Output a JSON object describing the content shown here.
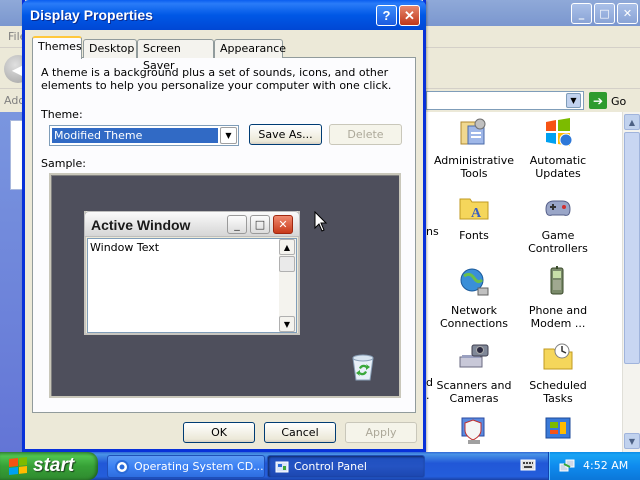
{
  "background_window": {
    "menu_file": "File",
    "address_label": "Address",
    "go_label": "Go",
    "items": [
      {
        "label_line1": "Administrative",
        "label_line2": "Tools",
        "icon": "administrative-tools-icon"
      },
      {
        "label_line1": "Automatic",
        "label_line2": "Updates",
        "icon": "automatic-updates-icon"
      },
      {
        "label_line1": "Fonts",
        "label_line2": "",
        "icon": "fonts-folder-icon"
      },
      {
        "label_line1": "Game",
        "label_line2": "Controllers",
        "icon": "game-controllers-icon"
      },
      {
        "label_line1": "Network",
        "label_line2": "Connections",
        "icon": "network-connections-icon"
      },
      {
        "label_line1": "Phone and",
        "label_line2": "Modem ...",
        "icon": "phone-and-modem-icon"
      },
      {
        "label_line1": "Scanners and",
        "label_line2": "Cameras",
        "icon": "scanners-cameras-icon"
      },
      {
        "label_line1": "Scheduled",
        "label_line2": "Tasks",
        "icon": "scheduled-tasks-icon"
      },
      {
        "label_line1": "",
        "label_line2": "",
        "icon": "security-center-icon"
      },
      {
        "label_line1": "",
        "label_line2": "",
        "icon": "system-icon"
      }
    ],
    "partial_labels": [
      "ns",
      "d",
      "."
    ]
  },
  "dialog": {
    "title": "Display Properties",
    "help_symbol": "?",
    "close_symbol": "✕",
    "tabs": [
      {
        "label": "Themes",
        "active": true
      },
      {
        "label": "Desktop",
        "active": false
      },
      {
        "label": "Screen Saver",
        "active": false
      },
      {
        "label": "Appearance",
        "active": false
      }
    ],
    "intro_text": "A theme is a background plus a set of sounds, icons, and other elements to help you personalize your computer with one click.",
    "theme_label": "Theme:",
    "theme_value": "Modified Theme",
    "save_as_label": "Save As...",
    "delete_label": "Delete",
    "sample_label": "Sample:",
    "sample_window": {
      "title": "Active Window",
      "text": "Window Text"
    },
    "ok_label": "OK",
    "cancel_label": "Cancel",
    "apply_label": "Apply"
  },
  "taskbar": {
    "start_label": "start",
    "tasks": [
      {
        "label": "Operating System CD...",
        "active": false
      },
      {
        "label": "Control Panel",
        "active": true
      }
    ],
    "clock": "4:52 AM"
  },
  "colors": {
    "dialog_title_blue": "#0058e6",
    "selection_blue": "#316ac5",
    "sample_desktop": "#4e4f5c",
    "taskbar_blue": "#245edb",
    "start_green": "#37a137"
  }
}
